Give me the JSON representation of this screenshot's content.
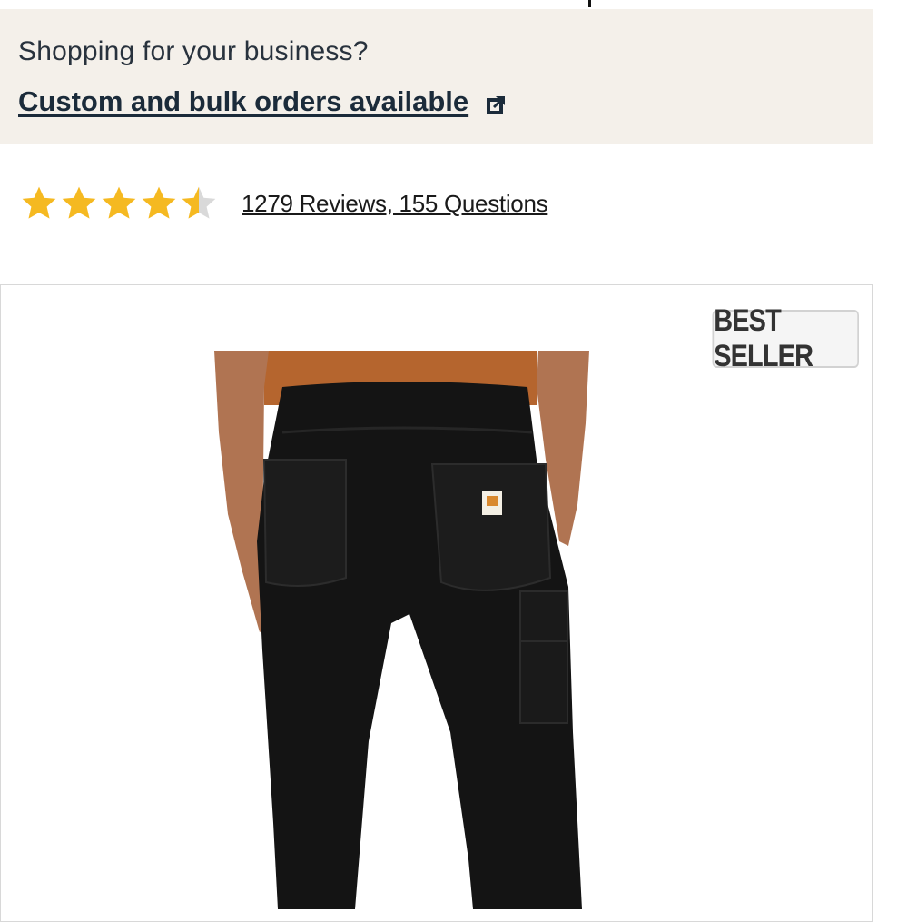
{
  "banner": {
    "question": "Shopping for your business?",
    "link_label": "Custom and bulk orders available",
    "link_icon": "external-link-icon"
  },
  "rating": {
    "value": 4.5,
    "max": 5,
    "star_color": "#f5b921",
    "reviews_label": "1279 Reviews, 155 Questions"
  },
  "product": {
    "badge": "BEST SELLER",
    "image_icon": "product-photo"
  },
  "colors": {
    "banner_bg": "#f4f0ea",
    "text": "#1b2b3a"
  }
}
